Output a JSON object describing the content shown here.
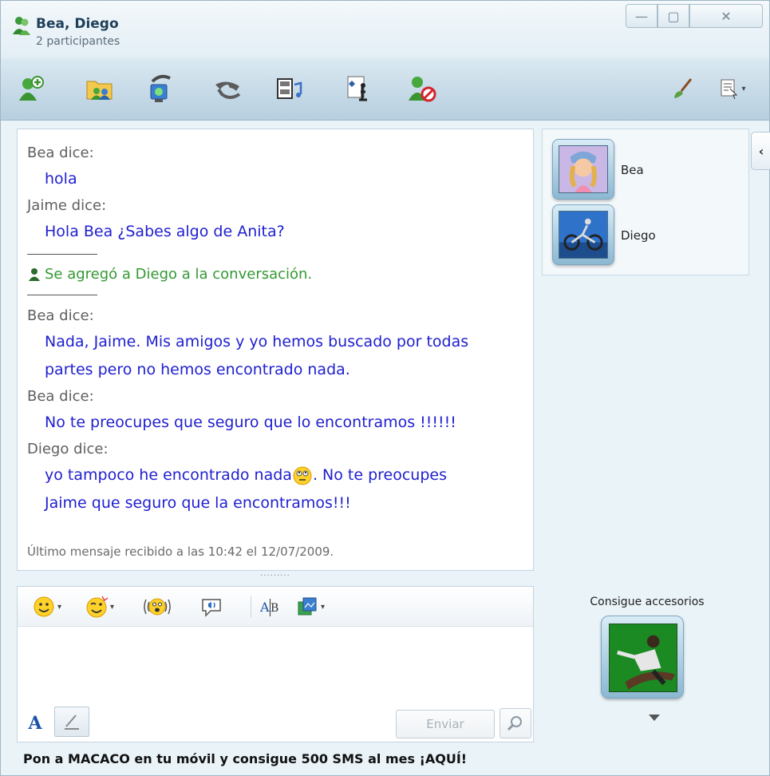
{
  "window": {
    "title": "Bea, Diego",
    "subtitle": "2 participantes",
    "controls": {
      "minimize": "—",
      "maximize": "▢",
      "close": "✕"
    }
  },
  "toolbar": {
    "items": [
      {
        "name": "invite-contact",
        "icon": "add-contact-icon"
      },
      {
        "name": "share-files",
        "icon": "folder-share-icon"
      },
      {
        "name": "video-call",
        "icon": "webcam-call-icon"
      },
      {
        "name": "voice-call",
        "icon": "phone-icon"
      },
      {
        "name": "activities",
        "icon": "media-activities-icon"
      },
      {
        "name": "games",
        "icon": "games-icon"
      },
      {
        "name": "block-contact",
        "icon": "block-contact-icon"
      }
    ],
    "right": [
      {
        "name": "theme",
        "icon": "brush-icon"
      },
      {
        "name": "menu",
        "icon": "menu-icon"
      }
    ]
  },
  "conversation": {
    "messages": [
      {
        "type": "msg",
        "sender": "Bea dice:",
        "lines": [
          "hola"
        ]
      },
      {
        "type": "msg",
        "sender": "Jaime dice:",
        "lines": [
          "Hola Bea ¿Sabes algo de Anita?"
        ]
      },
      {
        "type": "sep"
      },
      {
        "type": "sys",
        "text": "Se agregó a Diego a la conversación."
      },
      {
        "type": "sep"
      },
      {
        "type": "msg",
        "sender": "Bea dice:",
        "lines": [
          "Nada, Jaime. Mis amigos y yo hemos buscado por todas",
          "partes pero no hemos encontrado nada."
        ]
      },
      {
        "type": "msg",
        "sender": "Bea dice:",
        "lines": [
          "No te preocupes que seguro que lo encontramos !!!!!!"
        ]
      },
      {
        "type": "msg",
        "sender": "Diego dice:",
        "lines": [
          "yo tampoco he encontrado nada",
          ". No te preocupes",
          "Jaime que seguro que la encontramos!!!"
        ]
      }
    ],
    "last_received": "Último mensaje recibido a las 10:42 el 12/07/2009.",
    "splitter": "........."
  },
  "input": {
    "tools": [
      {
        "name": "emoticons",
        "icon": "smiley-icon"
      },
      {
        "name": "winks",
        "icon": "wink-icon"
      },
      {
        "name": "nudge",
        "icon": "nudge-icon"
      },
      {
        "name": "voice-clip",
        "icon": "voice-clip-icon"
      },
      {
        "name": "font",
        "icon": "font-icon",
        "label": "AB"
      },
      {
        "name": "backgrounds",
        "icon": "background-icon"
      }
    ],
    "placeholder": "",
    "format_text": "A",
    "send_label": "Enviar"
  },
  "participants": [
    {
      "name": "Bea",
      "avatar": "girl-avatar"
    },
    {
      "name": "Diego",
      "avatar": "motocross-avatar"
    }
  ],
  "accessories": {
    "label": "Consigue accesorios"
  },
  "ad": {
    "text": "Pon a MACACO en tu móvil y consigue 500 SMS al mes ¡AQUÍ!"
  },
  "colors": {
    "message_text": "#2020d0",
    "system_text": "#339933",
    "sender_text": "#5f5f5f"
  }
}
